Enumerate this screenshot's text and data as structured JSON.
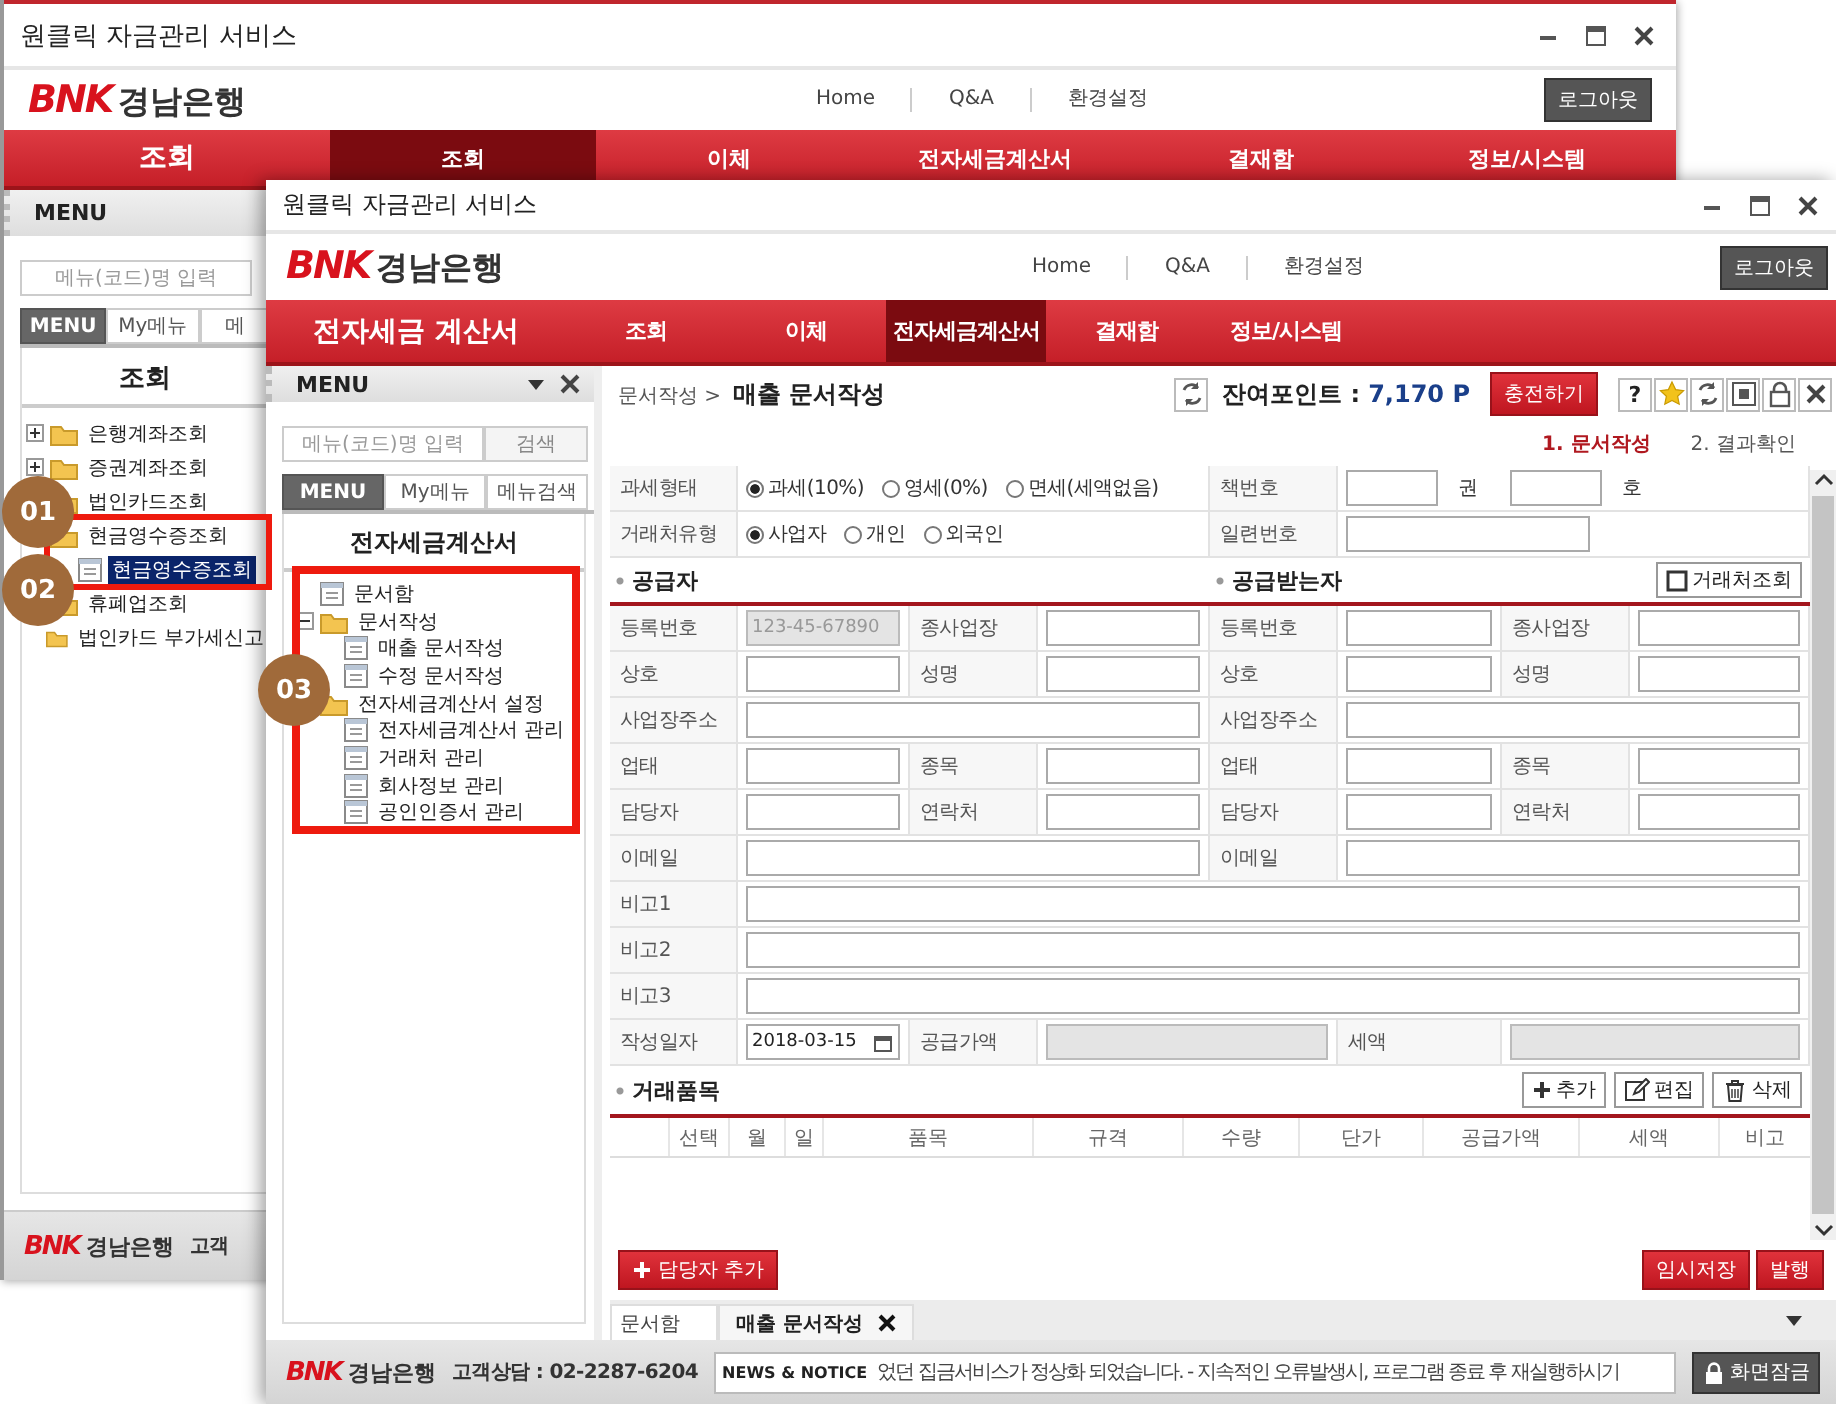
{
  "back_window": {
    "title": "원클릭 자금관리 서비스",
    "logo": {
      "mark": "BNK",
      "name": "경남은행"
    },
    "links": [
      "Home",
      "Q&A",
      "환경설정"
    ],
    "logout": "로그아웃",
    "section": "조회",
    "nav": [
      {
        "label": "조회",
        "selected": true
      },
      {
        "label": "이체",
        "selected": false
      },
      {
        "label": "전자세금계산서",
        "selected": false
      },
      {
        "label": "결재함",
        "selected": false
      },
      {
        "label": "정보/시스템",
        "selected": false
      }
    ],
    "sidebar": {
      "header": "MENU",
      "search_placeholder": "메뉴(코드)명 입력",
      "tabs": [
        {
          "label": "MENU",
          "selected": true
        },
        {
          "label": "My메뉴",
          "selected": false
        },
        {
          "label": "메",
          "selected": false
        }
      ],
      "title": "조회",
      "tree": [
        {
          "kind": "folder",
          "label": "은행계좌조회",
          "expanded": false,
          "selected": false
        },
        {
          "kind": "folder",
          "label": "증권계좌조회",
          "expanded": false,
          "selected": false
        },
        {
          "kind": "folder",
          "label": "법인카드조회",
          "selected": false
        },
        {
          "kind": "folder",
          "label": "현금영수증조회",
          "selected": false,
          "children": [
            {
              "kind": "page",
              "label": "현금영수증조회",
              "selected": true
            }
          ]
        },
        {
          "kind": "folder",
          "label": "휴폐업조회",
          "selected": false
        },
        {
          "kind": "folder",
          "label": "법인카드 부가세신고",
          "selected": false
        }
      ]
    },
    "footer": {
      "logo": {
        "mark": "BNK",
        "name": "경남은행"
      },
      "contact": "고객"
    }
  },
  "front_window": {
    "title": "원클릭 자금관리 서비스",
    "logo": {
      "mark": "BNK",
      "name": "경남은행"
    },
    "links": [
      "Home",
      "Q&A",
      "환경설정"
    ],
    "logout": "로그아웃",
    "section": "전자세금 계산서",
    "nav": [
      {
        "label": "조회",
        "selected": false
      },
      {
        "label": "이체",
        "selected": false
      },
      {
        "label": "전자세금계산서",
        "selected": true
      },
      {
        "label": "결재함",
        "selected": false
      },
      {
        "label": "정보/시스템",
        "selected": false
      }
    ],
    "sidebar": {
      "header": "MENU",
      "search_placeholder": "메뉴(코드)명 입력",
      "search_button": "검색",
      "tabs": [
        {
          "label": "MENU",
          "selected": true
        },
        {
          "label": "My메뉴",
          "selected": false
        },
        {
          "label": "메뉴검색",
          "selected": false
        }
      ],
      "title": "전자세금계산서",
      "tree": [
        {
          "kind": "page",
          "label": "문서함",
          "selected": false
        },
        {
          "kind": "folder",
          "label": "문서작성",
          "expanded": true,
          "selected": false,
          "children": [
            {
              "kind": "page",
              "label": "매출 문서작성",
              "selected": false
            },
            {
              "kind": "page",
              "label": "수정 문서작성",
              "selected": false
            }
          ]
        },
        {
          "kind": "folder",
          "label": "전자세금계산서 설정",
          "selected": false,
          "children": [
            {
              "kind": "page",
              "label": "전자세금계산서 관리",
              "selected": false
            },
            {
              "kind": "page",
              "label": "거래처 관리",
              "selected": false
            },
            {
              "kind": "page",
              "label": "회사정보 관리",
              "selected": false
            },
            {
              "kind": "page",
              "label": "공인인증서 관리",
              "selected": false
            }
          ]
        }
      ]
    },
    "content": {
      "breadcrumb": "문서작성 >",
      "page_title": "매출 문서작성",
      "points_label": "잔여포인트 :",
      "points": "7,170 P",
      "charge_button": "충전하기",
      "help_button": "?",
      "steps": [
        {
          "label": "1. 문서작성",
          "selected": true
        },
        {
          "label": "2. 결과확인",
          "selected": false
        }
      ],
      "tax_rows": [
        {
          "label": "과세형태",
          "options": [
            {
              "label": "과세(10%)",
              "selected": true
            },
            {
              "label": "영세(0%)",
              "selected": false
            },
            {
              "label": "면세(세액없음)",
              "selected": false
            }
          ],
          "side_label": "책번호",
          "units": [
            "권",
            "호"
          ]
        },
        {
          "label": "거래처유형",
          "options": [
            {
              "label": "사업자",
              "selected": true
            },
            {
              "label": "개인",
              "selected": false
            },
            {
              "label": "외국인",
              "selected": false
            }
          ],
          "side_label": "일련번호"
        }
      ],
      "party_headers": [
        "공급자",
        "공급받는자"
      ],
      "lookup_button": "거래처조회",
      "rows": [
        {
          "kind": "pair",
          "cells": [
            {
              "label": "등록번호",
              "value": "123-45-67890",
              "disabled": true
            },
            {
              "label": "종사업장",
              "disabled": false
            },
            {
              "label": "등록번호",
              "disabled": false
            },
            {
              "label": "종사업장",
              "disabled": false
            }
          ]
        },
        {
          "kind": "pair",
          "cells": [
            {
              "label": "상호",
              "disabled": false
            },
            {
              "label": "성명",
              "disabled": false
            },
            {
              "label": "상호",
              "disabled": false
            },
            {
              "label": "성명",
              "disabled": false
            }
          ]
        },
        {
          "kind": "wide",
          "cells": [
            {
              "label": "사업장주소",
              "disabled": false
            },
            {
              "label": "사업장주소",
              "disabled": false
            }
          ]
        },
        {
          "kind": "pair",
          "cells": [
            {
              "label": "업태",
              "disabled": false
            },
            {
              "label": "종목",
              "disabled": false
            },
            {
              "label": "업태",
              "disabled": false
            },
            {
              "label": "종목",
              "disabled": false
            }
          ]
        },
        {
          "kind": "pair",
          "cells": [
            {
              "label": "담당자",
              "disabled": false
            },
            {
              "label": "연락처",
              "disabled": false
            },
            {
              "label": "담당자",
              "disabled": false
            },
            {
              "label": "연락처",
              "disabled": false
            }
          ]
        },
        {
          "kind": "wide",
          "cells": [
            {
              "label": "이메일",
              "disabled": false
            },
            {
              "label": "이메일",
              "disabled": false
            }
          ]
        },
        {
          "kind": "full",
          "cells": [
            {
              "label": "비고1",
              "disabled": false
            }
          ]
        },
        {
          "kind": "full",
          "cells": [
            {
              "label": "비고2",
              "disabled": false
            }
          ]
        },
        {
          "kind": "full",
          "cells": [
            {
              "label": "비고3",
              "disabled": false
            }
          ]
        },
        {
          "kind": "date",
          "cells": [
            {
              "label": "작성일자",
              "value": "2018-03-15",
              "disabled": false
            },
            {
              "label": "공급가액",
              "disabled": true
            },
            {
              "label": "세액",
              "disabled": true
            }
          ]
        }
      ],
      "items": {
        "title": "거래품목",
        "buttons": [
          {
            "kind": "add",
            "label": "추가"
          },
          {
            "kind": "edit",
            "label": "편집"
          },
          {
            "kind": "delete",
            "label": "삭제"
          }
        ],
        "columns": [
          "선택",
          "월",
          "일",
          "품목",
          "규격",
          "수량",
          "단가",
          "공급가액",
          "세액",
          "비고"
        ]
      },
      "add_manager_button": "담당자 추가",
      "actions": [
        "임시저장",
        "발행"
      ],
      "doc_tabs": [
        {
          "label": "문서함",
          "selected": false,
          "closable": false
        },
        {
          "label": "매출 문서작성",
          "selected": true,
          "closable": true
        }
      ]
    },
    "footer": {
      "logo": {
        "mark": "BNK",
        "name": "경남은행"
      },
      "contact": "고객상담 : 02-2287-6204",
      "notice_label": "NEWS & NOTICE",
      "notice": "었던 집금서비스가 정상화 되었습니다. - 지속적인 오류발생시, 프로그램 종료 후 재실행하시기",
      "lock_button": "화면잠금"
    }
  },
  "annotations": [
    {
      "label": "01"
    },
    {
      "label": "02"
    },
    {
      "label": "03"
    }
  ]
}
